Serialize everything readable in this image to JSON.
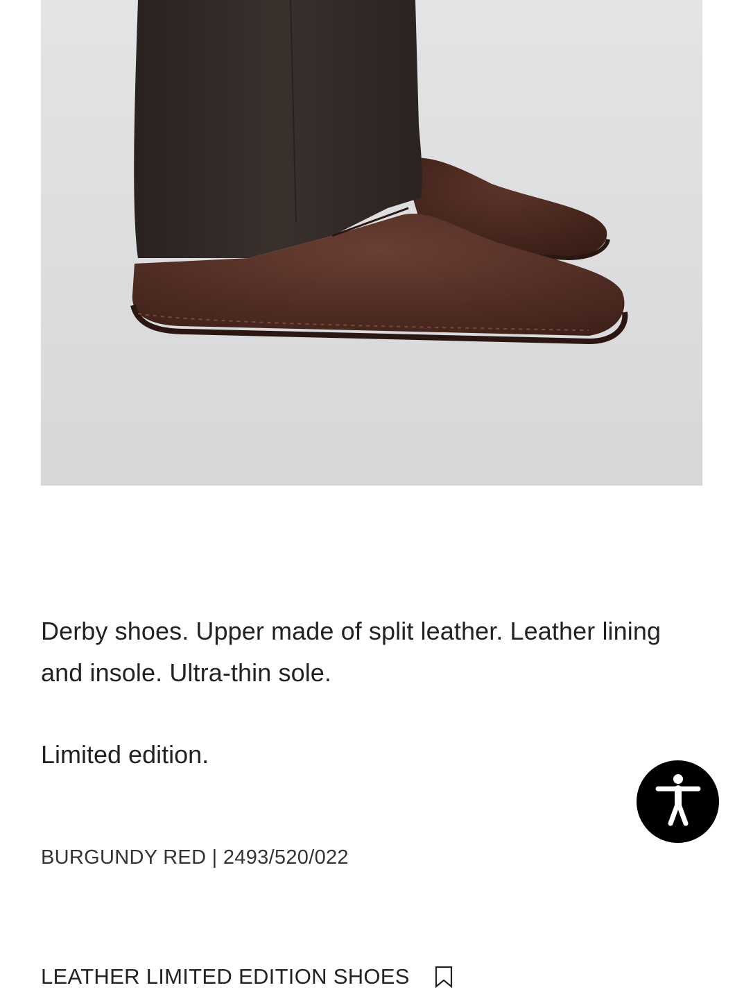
{
  "product": {
    "image_alt": "Brown suede derby shoe with dark trousers",
    "description": "Derby shoes. Upper made of split leather. Leather lining and insole. Ultra-thin sole.",
    "edition_note": "Limited edition.",
    "color_ref": "BURGUNDY RED | 2493/520/022",
    "name": "LEATHER LIMITED EDITION SHOES"
  },
  "icons": {
    "bookmark": "bookmark-icon",
    "accessibility": "accessibility-icon"
  },
  "colors": {
    "background": "#ffffff",
    "text": "#222222",
    "accessibility_button": "#000000",
    "shoe_suede": "#4a2a22",
    "trousers": "#2e2624"
  }
}
